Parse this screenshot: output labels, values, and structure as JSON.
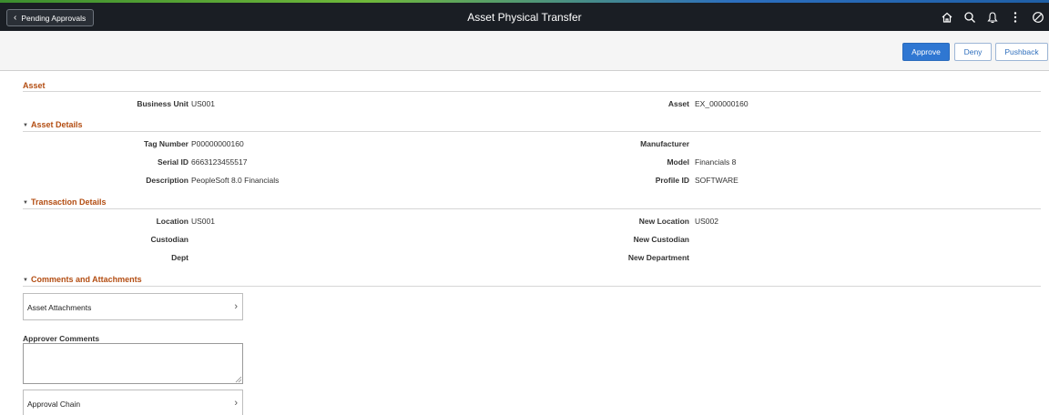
{
  "header": {
    "back_label": "Pending Approvals",
    "title": "Asset Physical Transfer",
    "icons": [
      "home-icon",
      "search-icon",
      "bell-icon",
      "more-vert-icon",
      "compass-icon"
    ]
  },
  "toolbar": {
    "approve_label": "Approve",
    "deny_label": "Deny",
    "pushback_label": "Pushback"
  },
  "asset": {
    "title": "Asset",
    "business_unit_label": "Business Unit",
    "business_unit": "US001",
    "asset_label": "Asset",
    "asset_id": "EX_000000160"
  },
  "asset_details": {
    "title": "Asset Details",
    "tag_number_label": "Tag Number",
    "tag_number": "P00000000160",
    "manufacturer_label": "Manufacturer",
    "manufacturer": "",
    "serial_id_label": "Serial ID",
    "serial_id": "6663123455517",
    "model_label": "Model",
    "model": "Financials 8",
    "description_label": "Description",
    "description": "PeopleSoft 8.0 Financials",
    "profile_id_label": "Profile ID",
    "profile_id": "SOFTWARE"
  },
  "transaction_details": {
    "title": "Transaction Details",
    "location_label": "Location",
    "location": "US001",
    "new_location_label": "New Location",
    "new_location": "US002",
    "custodian_label": "Custodian",
    "custodian": "",
    "new_custodian_label": "New Custodian",
    "new_custodian": "",
    "dept_label": "Dept",
    "dept": "",
    "new_department_label": "New Department",
    "new_department": ""
  },
  "comments": {
    "title": "Comments and Attachments",
    "asset_attachments_label": "Asset Attachments",
    "approver_comments_label": "Approver Comments",
    "approver_comments_value": "",
    "approval_chain_label": "Approval Chain"
  },
  "colors": {
    "header_bg": "#1a1e24",
    "section_title": "#b34d12",
    "primary_button": "#2f77d2"
  }
}
